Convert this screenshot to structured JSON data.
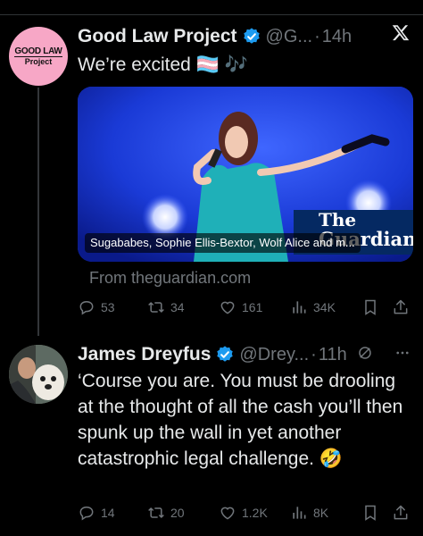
{
  "tweet1": {
    "avatar_line1": "GOOD LAW",
    "avatar_line2": "Project",
    "name": "Good Law Project",
    "handle": "@G...",
    "separator": "·",
    "time": "14h",
    "text": "We’re excited 🏳️‍⚧️ 🎶",
    "card": {
      "caption": "Sugababes, Sophie Ellis-Bextor, Wolf Alice and m...",
      "logo_line1": "The",
      "logo_line2": "Guardian"
    },
    "source": "From theguardian.com",
    "replies": "53",
    "reposts": "34",
    "likes": "161",
    "views": "34K"
  },
  "tweet2": {
    "name": "James Dreyfus",
    "handle": "@Drey...",
    "separator": "·",
    "time": "11h",
    "text": "‘Course you are. You must be drooling at the thought of all the cash you’ll then spunk up the wall in yet another catastrophic legal challenge. 🤣",
    "replies": "14",
    "reposts": "20",
    "likes": "1.2K",
    "views": "8K"
  },
  "colors": {
    "background": "#000000",
    "text": "#e7e9ea",
    "muted": "#71767b",
    "verified": "#1d9bf0",
    "card_blue": "#1c3fd9",
    "guardian_navy": "#052962"
  }
}
